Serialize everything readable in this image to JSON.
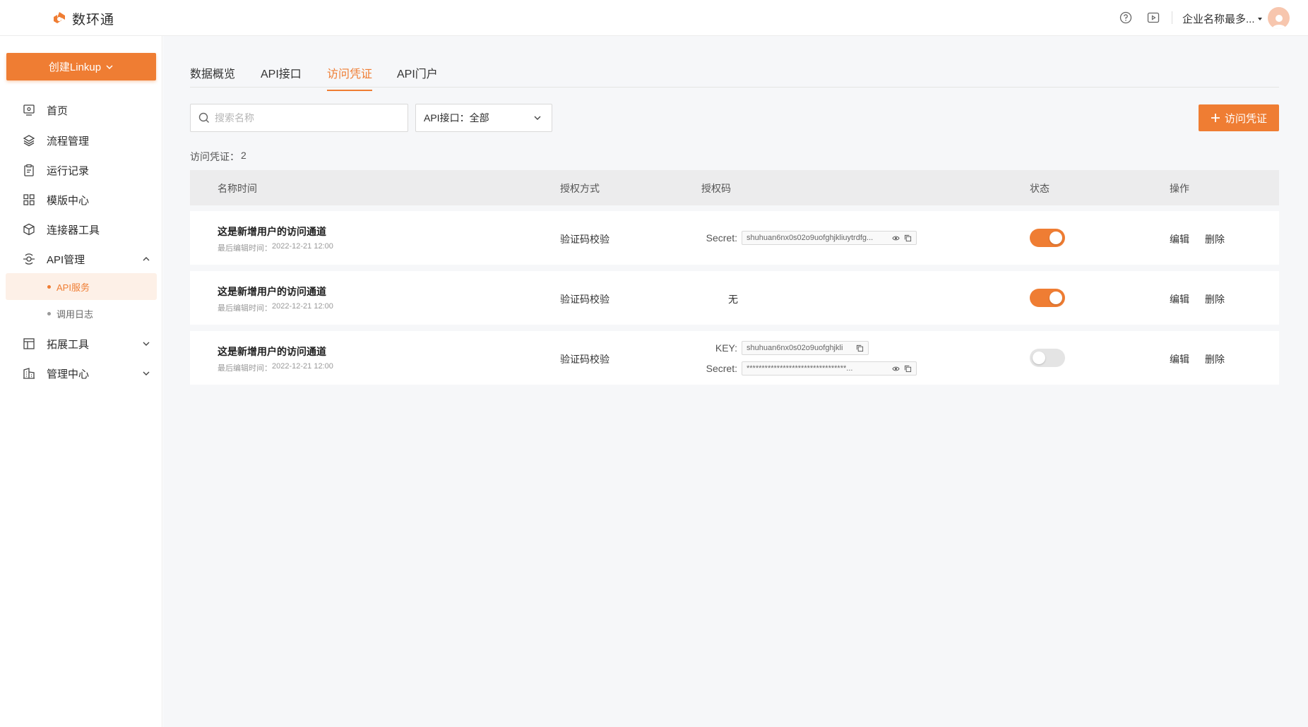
{
  "colors": {
    "accent": "#ef7d33",
    "accent_light": "#fdf0e7",
    "bg": "#f6f7f9"
  },
  "app": {
    "logo_text": "数环通",
    "company": "企业名称最多..."
  },
  "header": {
    "help_icon": "help-circle-icon",
    "video_icon": "video-play-icon"
  },
  "sidebar": {
    "create_label": "创建Linkup",
    "items": [
      {
        "label": "首页",
        "icon": "monitor-icon"
      },
      {
        "label": "流程管理",
        "icon": "layers-icon"
      },
      {
        "label": "运行记录",
        "icon": "clipboard-icon"
      },
      {
        "label": "模版中心",
        "icon": "grid-icon"
      },
      {
        "label": "连接器工具",
        "icon": "cube-icon"
      },
      {
        "label": "API管理",
        "icon": "api-icon",
        "expanded": true
      },
      {
        "label": "拓展工具",
        "icon": "layout-icon"
      },
      {
        "label": "管理中心",
        "icon": "building-icon"
      }
    ],
    "sub_items": [
      {
        "label": "API服务",
        "active": true
      },
      {
        "label": "调用日志",
        "active": false
      }
    ]
  },
  "tabs": [
    {
      "label": "数据概览",
      "active": false
    },
    {
      "label": "API接口",
      "active": false
    },
    {
      "label": "访问凭证",
      "active": true
    },
    {
      "label": "API门户",
      "active": false
    }
  ],
  "filters": {
    "search_placeholder": "搜索名称",
    "select_label": "API接口：",
    "select_value": "全部",
    "add_button": "访问凭证"
  },
  "count": {
    "label": "访问凭证：",
    "value": "2"
  },
  "table": {
    "headers": [
      "名称时间",
      "授权方式",
      "授权码",
      "状态",
      "操作"
    ],
    "rows": [
      {
        "name": "这是新增用户的访问通道",
        "time_label": "最后编辑时间：",
        "time": "2022-12-21 12:00",
        "auth": "验证码校验",
        "secret_label": "Secret:",
        "secret": "shuhuan6nx0s02o9uofghjkliuytrdfg...",
        "status": true,
        "edit": "编辑",
        "delete": "删除"
      },
      {
        "name": "这是新增用户的访问通道",
        "time_label": "最后编辑时间：",
        "time": "2022-12-21 12:00",
        "auth": "验证码校验",
        "none": "无",
        "status": true,
        "edit": "编辑",
        "delete": "删除"
      },
      {
        "name": "这是新增用户的访问通道",
        "time_label": "最后编辑时间：",
        "time": "2022-12-21 12:00",
        "auth": "验证码校验",
        "key_label": "KEY:",
        "key": "shuhuan6nx0s02o9uofghjkli",
        "secret_label": "Secret:",
        "secret": "*********************************...",
        "status": false,
        "edit": "编辑",
        "delete": "删除"
      }
    ]
  }
}
